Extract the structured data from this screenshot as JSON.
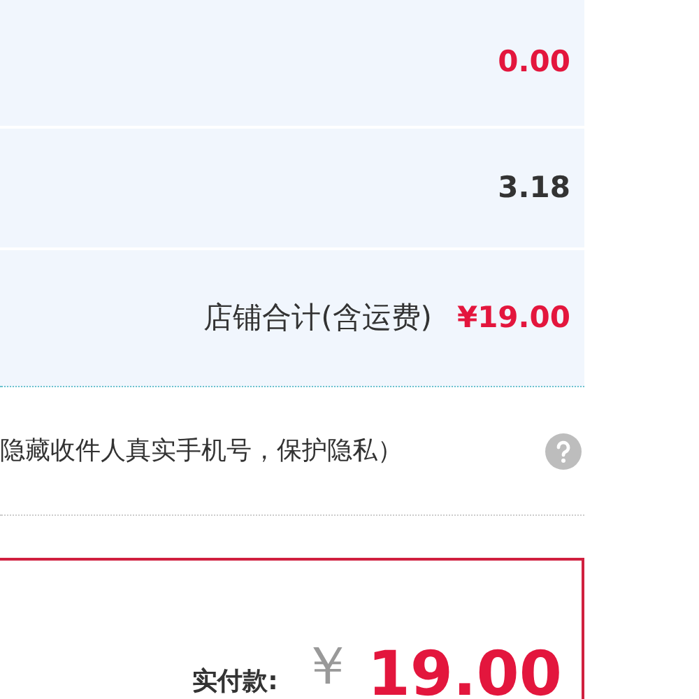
{
  "summary_rows": [
    {
      "value": "0.00",
      "highlighted": true
    },
    {
      "value": "3.18",
      "highlighted": false
    },
    {
      "label": "店铺合计(含运费)",
      "value": "¥19.00",
      "highlighted": true
    }
  ],
  "privacy_note": {
    "text": "隐藏收件人真实手机号，保护隐私）"
  },
  "payment": {
    "label": "实付款:",
    "currency": "￥",
    "amount": "19.00"
  }
}
